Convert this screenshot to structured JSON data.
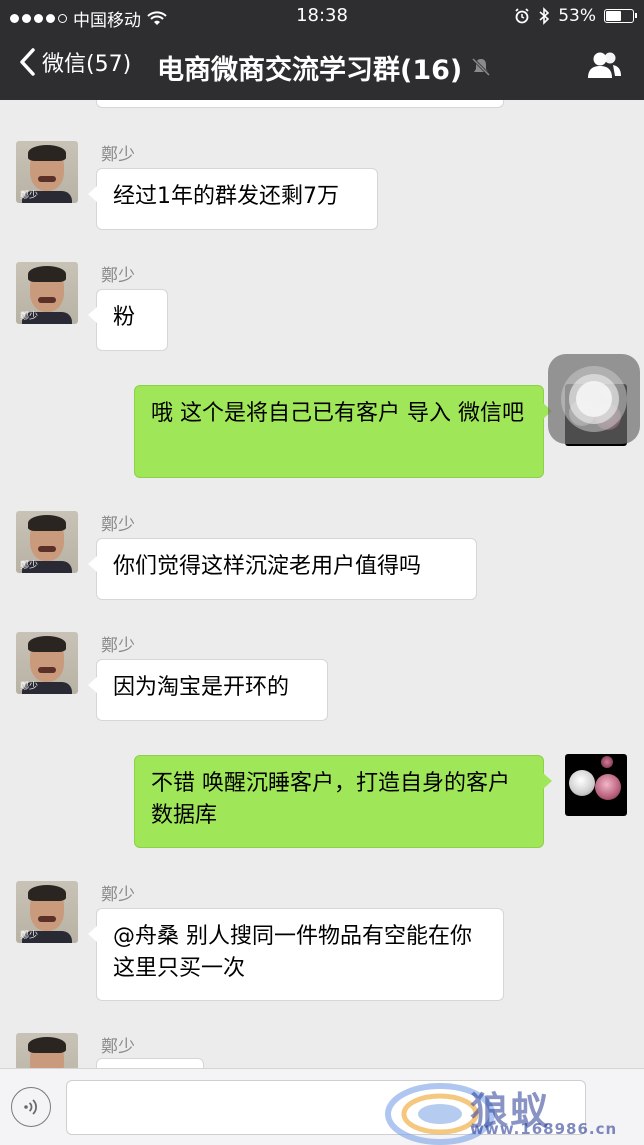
{
  "status_bar": {
    "carrier": "中国移动",
    "time": "18:38",
    "battery": "53%"
  },
  "nav": {
    "back_label": "微信(57)",
    "title": "电商微商交流学习群(16)"
  },
  "messages": [
    {
      "sender": "鄭少",
      "text": "经过1年的群发还剩7万"
    },
    {
      "sender": "鄭少",
      "text": "粉"
    },
    {
      "text": "哦 这个是将自己已有客户 导入 微信吧"
    },
    {
      "sender": "鄭少",
      "text": "你们觉得这样沉淀老用户值得吗"
    },
    {
      "sender": "鄭少",
      "text": "因为淘宝是开环的"
    },
    {
      "text": "不错  唤醒沉睡客户，打造自身的客户数据库"
    },
    {
      "sender": "鄭少",
      "text": "@舟桑 别人搜同一件物品有空能在你这里只买一次"
    },
    {
      "sender": "鄭少",
      "text": ""
    }
  ],
  "avatar_tag": "鄭少",
  "watermark": {
    "text": "狼蚁",
    "url": "www.168986.cn"
  },
  "colors": {
    "nav_bg": "#2e2e31",
    "chat_bg": "#ececec",
    "sent_bubble": "#9fe658",
    "received_bubble": "#ffffff"
  }
}
